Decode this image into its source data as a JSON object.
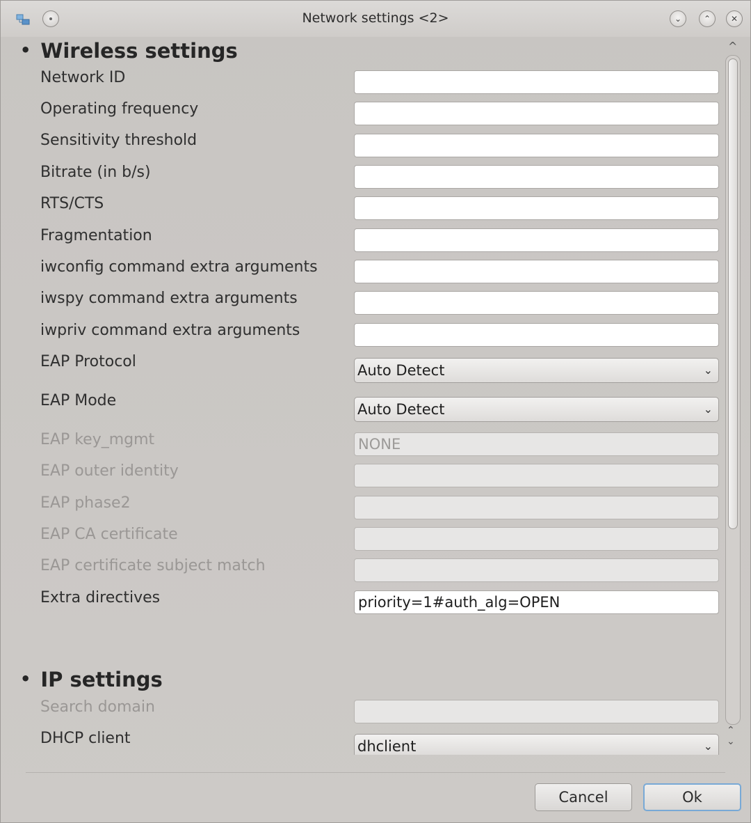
{
  "window": {
    "title": "Network settings <2>",
    "app_icon": "network-icon",
    "pin_icon": "pin-icon",
    "minimize_icon": "chevron-down-icon",
    "maximize_icon": "chevron-up-icon",
    "close_icon": "close-icon"
  },
  "wireless": {
    "title": "Wireless settings",
    "rows": [
      {
        "label": "Network ID",
        "value": ""
      },
      {
        "label": "Operating frequency",
        "value": ""
      },
      {
        "label": "Sensitivity threshold",
        "value": ""
      },
      {
        "label": "Bitrate (in b/s)",
        "value": ""
      },
      {
        "label": "RTS/CTS",
        "value": ""
      },
      {
        "label": "Fragmentation",
        "value": ""
      },
      {
        "label": "iwconfig command extra arguments",
        "value": ""
      },
      {
        "label": "iwspy command extra arguments",
        "value": ""
      },
      {
        "label": "iwpriv command extra arguments",
        "value": ""
      },
      {
        "label": "EAP Protocol",
        "value": "Auto Detect"
      },
      {
        "label": "EAP Mode",
        "value": "Auto Detect"
      },
      {
        "label": "EAP key_mgmt",
        "value": "NONE"
      },
      {
        "label": "EAP outer identity",
        "value": ""
      },
      {
        "label": "EAP phase2",
        "value": ""
      },
      {
        "label": "EAP CA certificate",
        "value": ""
      },
      {
        "label": "EAP certificate subject match",
        "value": ""
      },
      {
        "label": "Extra directives",
        "value": "priority=1#auth_alg=OPEN"
      }
    ]
  },
  "ip": {
    "title": "IP settings",
    "rows": [
      {
        "label": "Search domain",
        "value": ""
      },
      {
        "label": "DHCP client",
        "value": "dhclient"
      }
    ]
  },
  "buttons": {
    "cancel": "Cancel",
    "ok": "Ok"
  },
  "glyphs": {
    "bullet": "•",
    "combo_arrow": "⌄",
    "scroll_up": "^",
    "scroll_small_up": "⌃",
    "scroll_small_down": "⌄",
    "pin": "",
    "min": "⌄",
    "max": "⌃",
    "close": "✕"
  }
}
